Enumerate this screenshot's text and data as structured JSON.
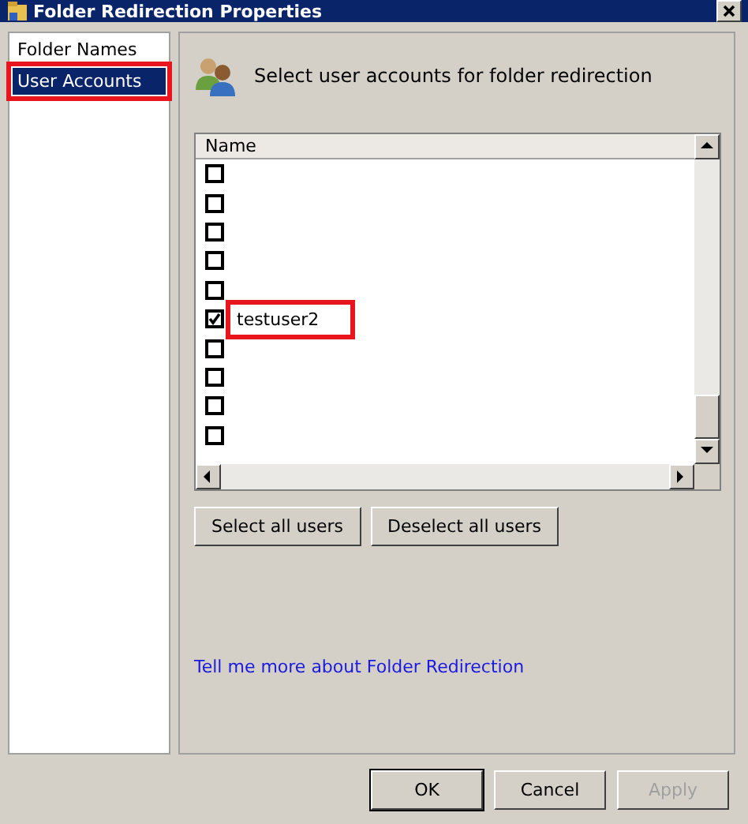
{
  "window": {
    "title": "Folder Redirection Properties"
  },
  "sidebar": {
    "items": [
      {
        "label": "Folder Names",
        "selected": false,
        "highlighted": false
      },
      {
        "label": "User Accounts",
        "selected": true,
        "highlighted": true
      }
    ]
  },
  "heading": "Select user accounts for folder redirection",
  "users": {
    "column": "Name",
    "rows": [
      {
        "checked": false,
        "highlighted": false
      },
      {
        "checked": false,
        "highlighted": false
      },
      {
        "checked": false,
        "highlighted": false
      },
      {
        "checked": false,
        "highlighted": false
      },
      {
        "checked": false,
        "highlighted": false
      },
      {
        "name": "testuser2",
        "checked": true,
        "highlighted": true
      },
      {
        "checked": false,
        "highlighted": false
      },
      {
        "checked": false,
        "highlighted": false
      },
      {
        "checked": false,
        "highlighted": false
      },
      {
        "checked": false,
        "highlighted": false
      }
    ]
  },
  "list_buttons": [
    "Select all users",
    "Deselect all users"
  ],
  "link": "Tell me more about Folder Redirection",
  "buttons": [
    {
      "label": "OK",
      "kind": "default",
      "disabled": false
    },
    {
      "label": "Cancel",
      "kind": "normal",
      "disabled": false
    },
    {
      "label": "Apply",
      "kind": "normal",
      "disabled": true
    }
  ]
}
